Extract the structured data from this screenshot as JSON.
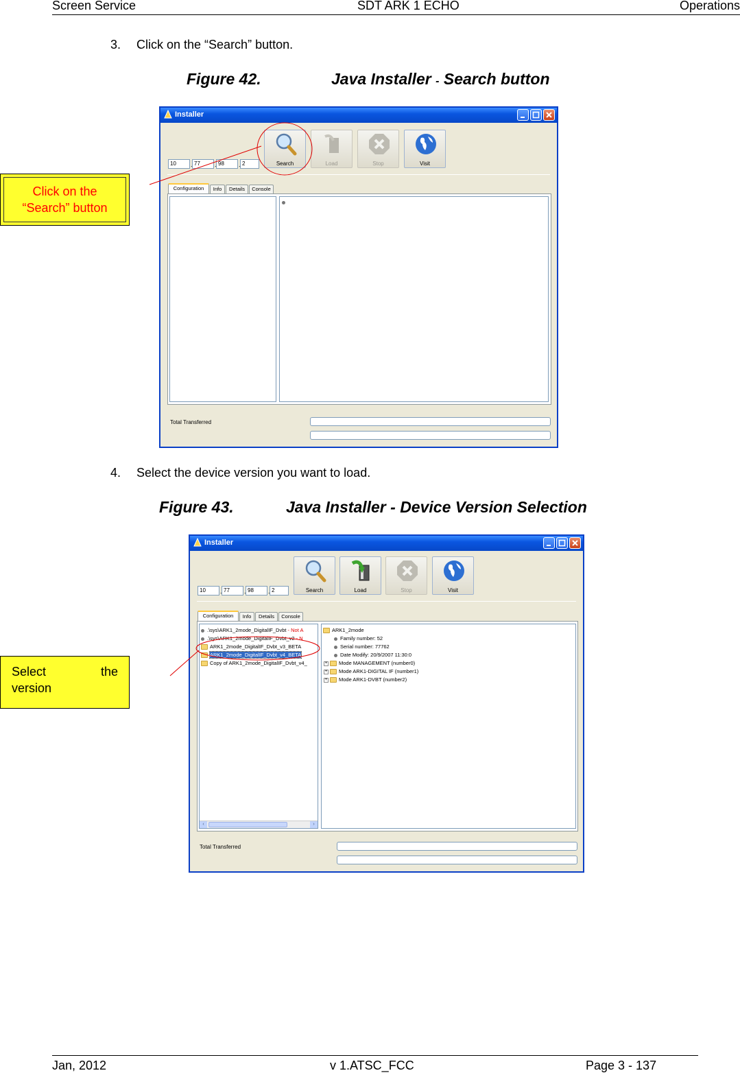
{
  "header": {
    "left": "Screen Service",
    "center": "SDT ARK 1 ECHO",
    "right": "Operations"
  },
  "footer": {
    "left": "Jan, 2012",
    "center": "v 1.ATSC_FCC",
    "right": "Page 3 - 137"
  },
  "steps": [
    {
      "num": "3.",
      "text": "Click on the “Search” button."
    },
    {
      "num": "4.",
      "text": "Select the device version you want to load."
    }
  ],
  "figures": [
    {
      "num": "Figure 42.",
      "title_a": "Java Installer ",
      "title_dash": "-",
      "title_b": " Search button"
    },
    {
      "num": "Figure 43.",
      "title": "Java Installer - Device Version Selection"
    }
  ],
  "callouts": [
    {
      "line1": "Click on the",
      "line2": "“Search” button"
    },
    {
      "word1": "Select",
      "word2": "the",
      "line2": "version"
    }
  ],
  "installer": {
    "title": "Installer",
    "ip": [
      "10",
      "77",
      "98",
      "2"
    ],
    "buttons": {
      "search": "Search",
      "load": "Load",
      "stop": "Stop",
      "visit": "Visit"
    },
    "tabs": [
      "Configuration",
      "Info",
      "Details",
      "Console"
    ],
    "total_transferred": "Total Transferred"
  },
  "file_list": [
    {
      "text": ".\\sys\\ARK1_2mode_DigitalIF_Dvbt",
      "red": " - Not A"
    },
    {
      "text": ".\\sys\\ARK1_2mode_DigitalIF_Dvbt_v2",
      "red": " - N"
    },
    {
      "text": "ARK1_2mode_DigitalIF_Dvbt_v3_BETA",
      "red": ""
    },
    {
      "text": "ARK1_2mode_DigitalIF_Dvbt_v4_BETA",
      "red": ""
    },
    {
      "text": "Copy of ARK1_2mode_DigitalIF_Dvbt_v4_",
      "red": ""
    }
  ],
  "detail_tree": {
    "root": "ARK1_2mode",
    "props": [
      "Family number: 52",
      "Serial number: 77762",
      "Date Modify: 20/9/2007  11:30:0"
    ],
    "modes": [
      "Mode MANAGEMENT (number0)",
      "Mode ARK1-DIGITAL IF (number1)",
      "Mode ARK1-DVBT (number2)"
    ]
  },
  "colors": {
    "callout_bg": "#ffff2e",
    "callout_text_1": "#ff0000",
    "annotation_line": "#e00000",
    "titlebar": "#0748c8",
    "selection": "#316ac5"
  }
}
